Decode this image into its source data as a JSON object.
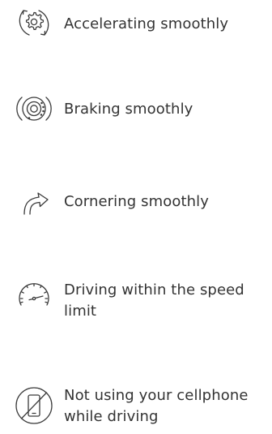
{
  "criteria": [
    {
      "icon": "accelerate-gear-icon",
      "label": "Accelerating smoothly"
    },
    {
      "icon": "brake-disc-icon",
      "label": "Braking smoothly"
    },
    {
      "icon": "turn-arrow-icon",
      "label": "Cornering smoothly"
    },
    {
      "icon": "speedometer-icon",
      "label": "Driving within the speed limit"
    },
    {
      "icon": "no-phone-icon",
      "label": "Not using your cellphone while driving"
    }
  ],
  "colors": {
    "text": "#333333",
    "icon_stroke": "#3a3a3a",
    "background": "#ffffff"
  }
}
